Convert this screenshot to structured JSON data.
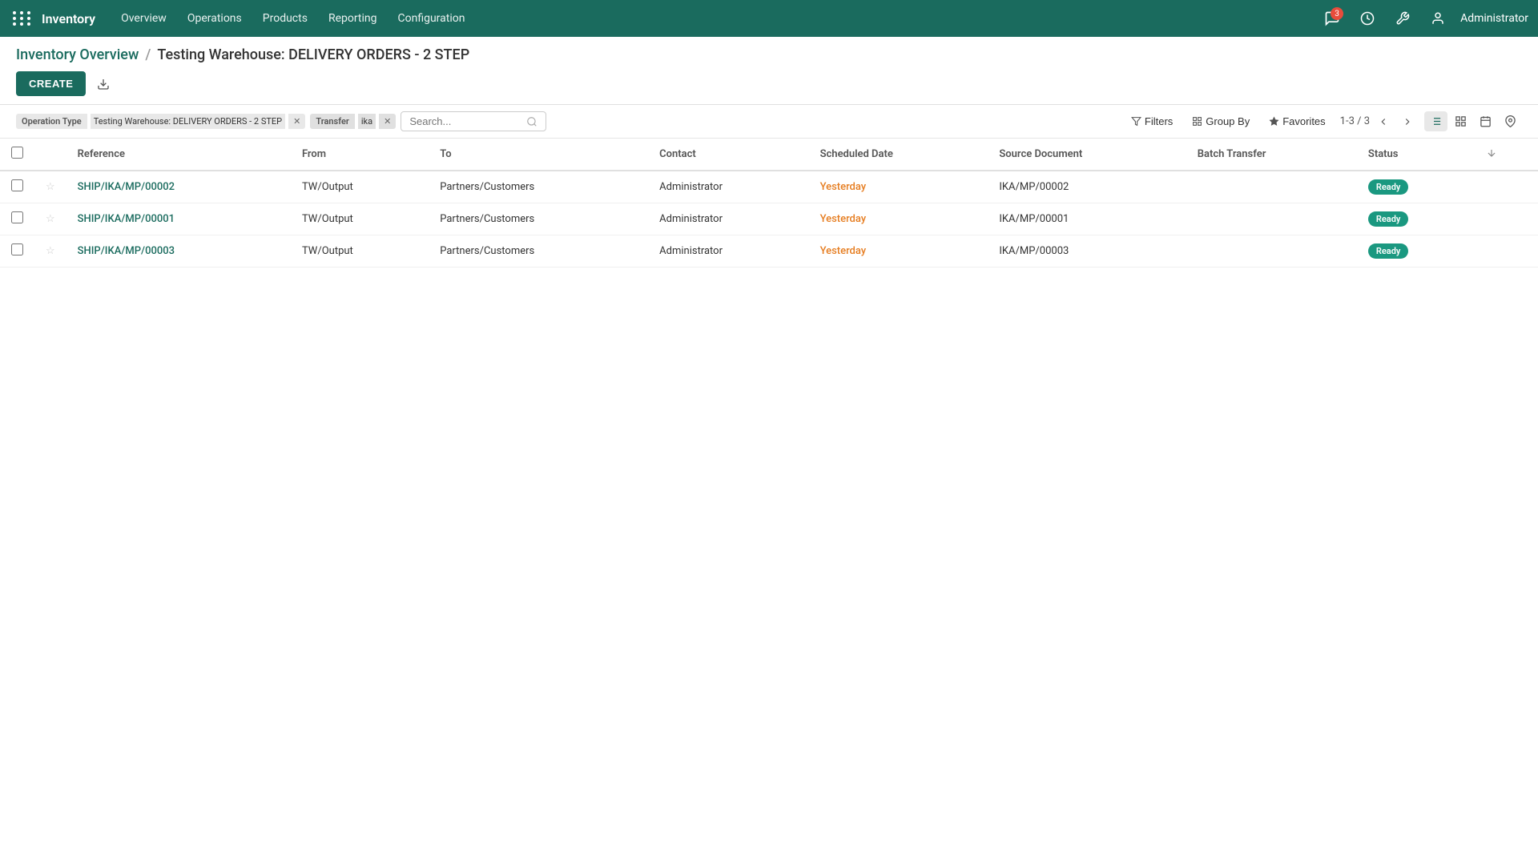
{
  "nav": {
    "brand": "Inventory",
    "menu_items": [
      "Overview",
      "Operations",
      "Products",
      "Reporting",
      "Configuration"
    ],
    "notification_count": "3",
    "user": "Administrator"
  },
  "breadcrumb": {
    "parent": "Inventory Overview",
    "separator": "/",
    "current": "Testing Warehouse: DELIVERY ORDERS - 2 STEP"
  },
  "toolbar": {
    "create_label": "CREATE"
  },
  "filters": {
    "operation_type_label": "Operation Type",
    "operation_type_value": "Testing Warehouse: DELIVERY ORDERS - 2 STEP",
    "transfer_label": "Transfer",
    "transfer_value": "ika",
    "search_placeholder": "Search..."
  },
  "filter_actions": {
    "filters_label": "Filters",
    "group_by_label": "Group By",
    "favorites_label": "Favorites"
  },
  "pagination": {
    "text": "1-3 / 3"
  },
  "table": {
    "columns": [
      "Reference",
      "From",
      "To",
      "Contact",
      "Scheduled Date",
      "Source Document",
      "Batch Transfer",
      "Status"
    ],
    "rows": [
      {
        "reference": "SHIP/IKA/MP/00002",
        "from": "TW/Output",
        "to": "Partners/Customers",
        "contact": "Administrator",
        "scheduled_date": "Yesterday",
        "source_document": "IKA/MP/00002",
        "batch_transfer": "",
        "status": "Ready"
      },
      {
        "reference": "SHIP/IKA/MP/00001",
        "from": "TW/Output",
        "to": "Partners/Customers",
        "contact": "Administrator",
        "scheduled_date": "Yesterday",
        "source_document": "IKA/MP/00001",
        "batch_transfer": "",
        "status": "Ready"
      },
      {
        "reference": "SHIP/IKA/MP/00003",
        "from": "TW/Output",
        "to": "Partners/Customers",
        "contact": "Administrator",
        "scheduled_date": "Yesterday",
        "source_document": "IKA/MP/00003",
        "batch_transfer": "",
        "status": "Ready"
      }
    ]
  }
}
